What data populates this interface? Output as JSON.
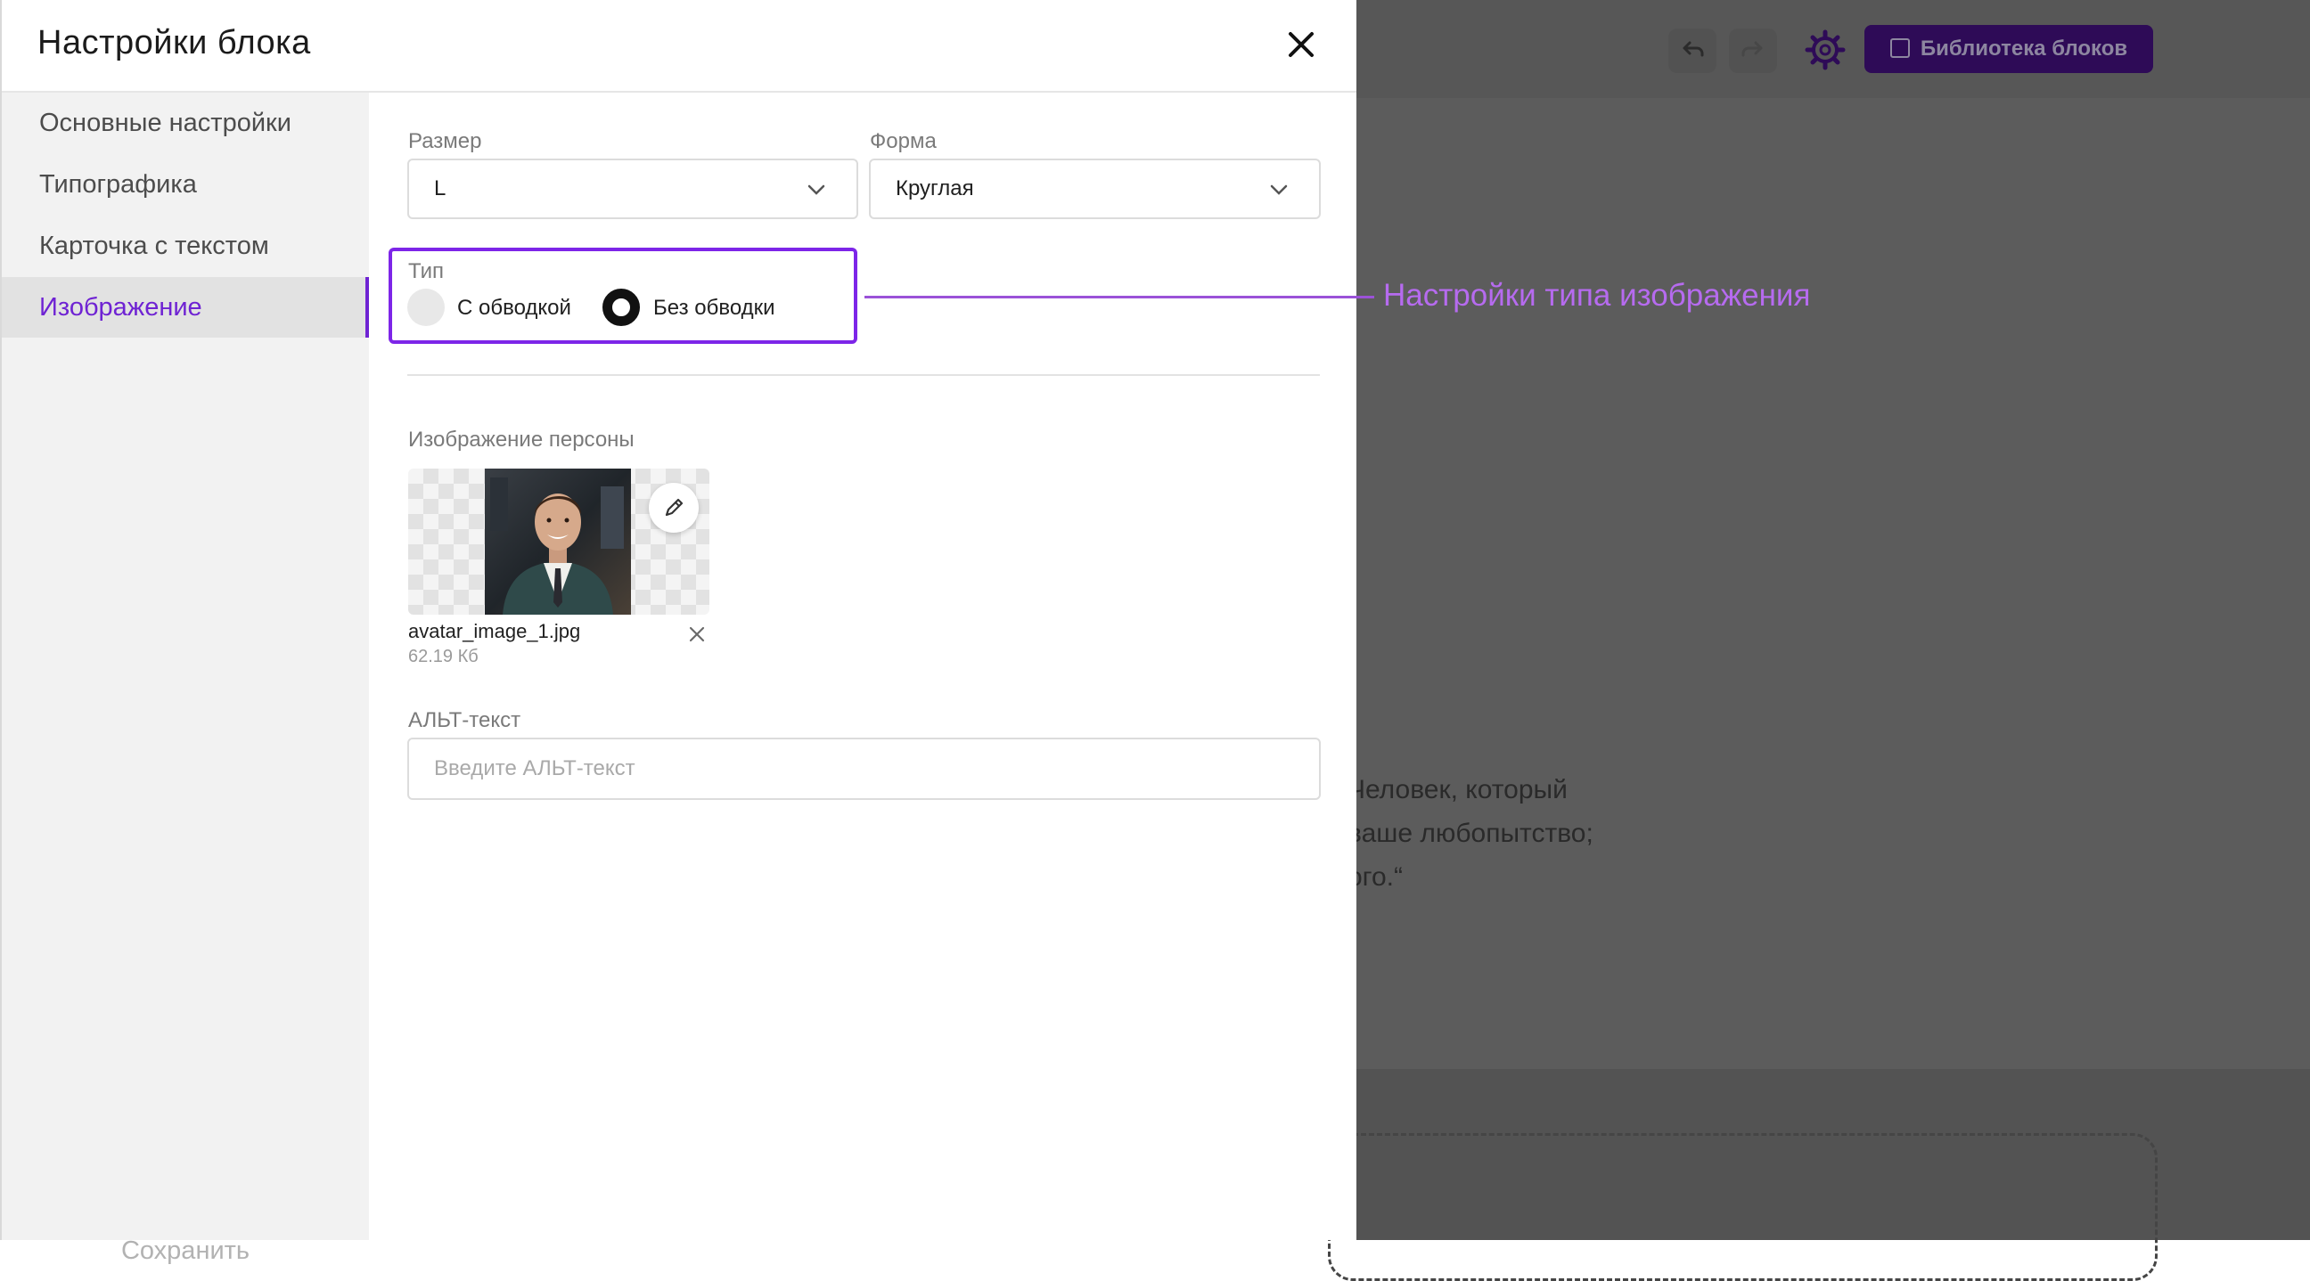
{
  "background": {
    "toolbar": {
      "undo_icon": "undo-icon",
      "redo_icon": "redo-icon",
      "settings_icon": "gear-icon",
      "library_button_label": "Библиотека блоков",
      "library_button_color": "#2e0b57"
    },
    "quote_lines": [
      "Человек, который",
      "ваше любопытство;",
      "ого.“"
    ]
  },
  "panel": {
    "title": "Настройки блока",
    "close_icon": "close-icon",
    "sidebar": {
      "items": [
        {
          "label": "Основные настройки",
          "active": false
        },
        {
          "label": "Типографика",
          "active": false
        },
        {
          "label": "Карточка с текстом",
          "active": false
        },
        {
          "label": "Изображение",
          "active": true
        }
      ],
      "save_label": "Сохранить"
    },
    "size": {
      "label": "Размер",
      "value": "L"
    },
    "shape": {
      "label": "Форма",
      "value": "Круглая"
    },
    "type": {
      "label": "Тип",
      "options": [
        {
          "label": "С обводкой",
          "selected": false
        },
        {
          "label": "Без обводки",
          "selected": true
        }
      ]
    },
    "person_image": {
      "label": "Изображение персоны",
      "file_name": "avatar_image_1.jpg",
      "file_size": "62.19 Кб",
      "edit_icon": "pencil-icon",
      "remove_icon": "close-icon"
    },
    "alt_text": {
      "label": "АЛЬТ-текст",
      "placeholder": "Введите АЛЬТ-текст",
      "value": ""
    }
  },
  "annotation": {
    "text": "Настройки типа изображения",
    "color": "#b66bef"
  },
  "colors": {
    "accent": "#6f23d3",
    "highlight_border": "#7d25e8"
  }
}
